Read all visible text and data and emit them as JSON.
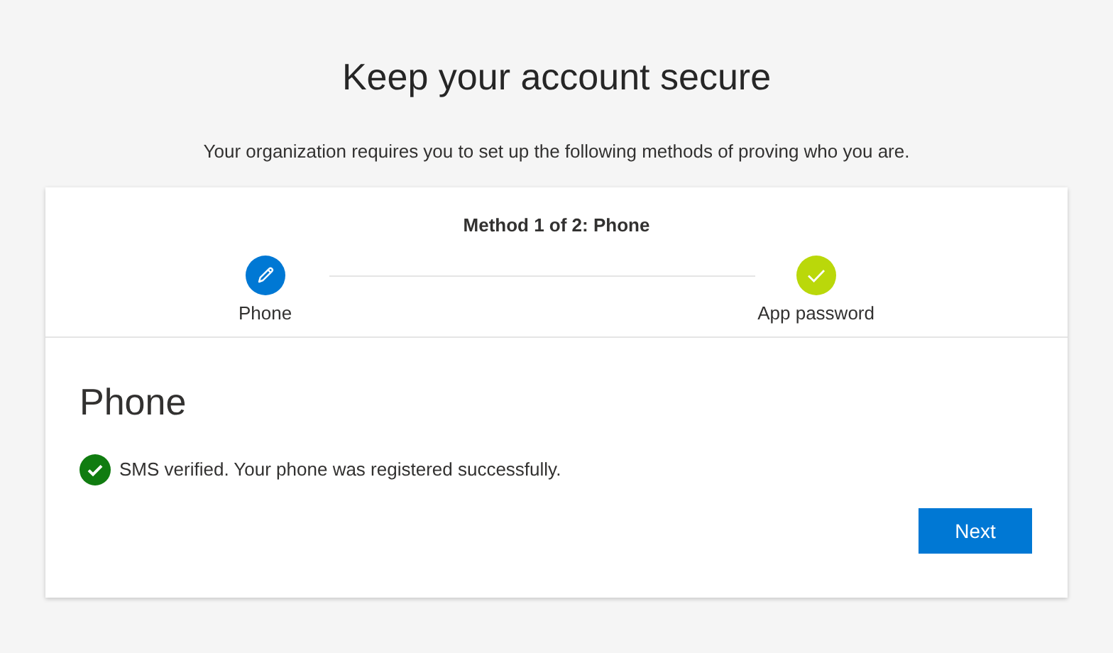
{
  "title": "Keep your account secure",
  "subtitle": "Your organization requires you to set up the following methods of proving who you are.",
  "progress": {
    "label": "Method 1 of 2: Phone",
    "steps": [
      {
        "label": "Phone",
        "kind": "current"
      },
      {
        "label": "App password",
        "kind": "complete"
      }
    ]
  },
  "section": {
    "heading": "Phone",
    "message": "SMS verified. Your phone was registered successfully.",
    "next_button": "Next"
  }
}
